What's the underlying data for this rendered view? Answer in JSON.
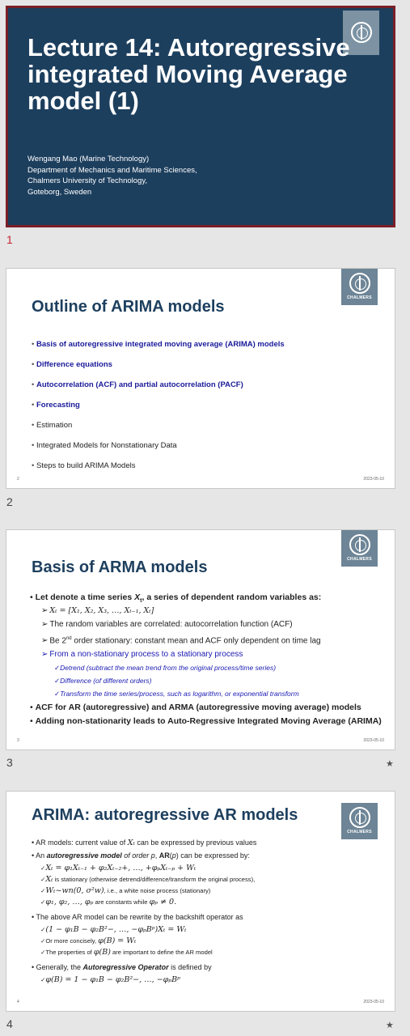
{
  "slides": [
    {
      "number": "1",
      "title": "Lecture 14: Autoregressive integrated Moving Average model (1)",
      "author_lines": [
        "Wengang Mao (Marine Technology)",
        "Department of Mechanics and Maritime Sciences,",
        "Chalmers University of Technology,",
        "Goteborg, Sweden"
      ]
    },
    {
      "number": "2",
      "title": "Outline of ARIMA models",
      "items": [
        "Basis of autoregressive integrated moving average (ARIMA)  models",
        "Difference equations",
        "Autocorrelation (ACF) and partial autocorrelation (PACF)",
        "Forecasting",
        "Estimation",
        "Integrated Models for Nonstationary Data",
        "Steps to build ARIMA Models"
      ],
      "footer_page": "2",
      "footer_date": "2023-05-10"
    },
    {
      "number": "3",
      "title": "Basis of ARMA models",
      "bullet1_a": "Let denote a time series ",
      "bullet1_var": "X",
      "bullet1_sub": "t",
      "bullet1_b": ", a series of dependent random variables as:",
      "eq1": "Xₜ = [X₁, X₂, X₃, …, Xₜ₋₁, Xₜ]",
      "sub2": "The random variables are correlated: autocorrelation function (ACF)",
      "sub3_a": "Be 2",
      "sub3_sup": "nd",
      "sub3_b": " order stationary: constant mean and ACF only dependent on time lag",
      "sub4": "From a non-stationary process to a stationary process",
      "check1": "Detrend (subtract the mean trend from the original process/time series)",
      "check2": "Difference (of different orders)",
      "check3": "Transform the time series/process, such as logarithm, or exponential transform",
      "bullet2": "ACF for AR (autoregressive) and ARMA (autoregressive moving average) models",
      "bullet3": "Adding non-stationarity leads to Auto-Regressive Integrated Moving Average (ARIMA)",
      "footer_page": "3",
      "footer_date": "2023-05-10",
      "star": "★"
    },
    {
      "number": "4",
      "title": "ARIMA: autoregressive AR models",
      "p1_a": "AR models: current value of ",
      "p1_var": "Xₜ",
      "p1_b": " can be expressed by previous values",
      "p2_a": "An ",
      "p2_em": "autoregressive model",
      "p2_b": " of order ",
      "p2_p": "p",
      "p2_c": ", ",
      "p2_ar": "AR",
      "p2_d": "(",
      "p2_p2": "p",
      "p2_e": ") can be expressed by:",
      "c1": "Xₜ = φ₁Xₜ₋₁ + φ₂Xₜ₋₂+, …, +φₚXₜ₋ₚ + Wₜ",
      "c2_var": "Xₜ",
      "c2_text": " is stationary (otherwise detrend/difference/transform the original process),",
      "c3_var": "Wₜ~wn(0, σ²w)",
      "c3_text": ", i.e., a white noise process (stationary)",
      "c4_var": "φ₁, φ₂, …, φₚ",
      "c4_text": " are constants while ",
      "c4_var2": "φₚ ≠ 0.",
      "p3": "The above AR model can be rewrite by the backshift operator as",
      "c5": "(1 − φ₁B − φ₂B²−, …, −φₚBᵖ)Xₜ = Wₜ",
      "c6_text": "Or more concisely,",
      "c6_var": "φ(B) = Wₜ",
      "c7_a": "The properties of ",
      "c7_var": "φ(B)",
      "c7_b": " are important to define the AR model",
      "p4_a": "Generally, the ",
      "p4_em": "Autoregressive Operator",
      "p4_b": " is defined by",
      "c8": "φ(B) = 1 − φ₁B − φ₂B²−, …, −φₚBᵖ",
      "footer_page": "4",
      "footer_date": "2023-05-10",
      "star": "★"
    }
  ],
  "logo_text": "CHALMERS",
  "colors": {
    "title_bg": "#1d3f5e",
    "selection_border": "#7a1f27",
    "blue_text": "#1a1a9a",
    "logo_bg": "#6d8596"
  }
}
